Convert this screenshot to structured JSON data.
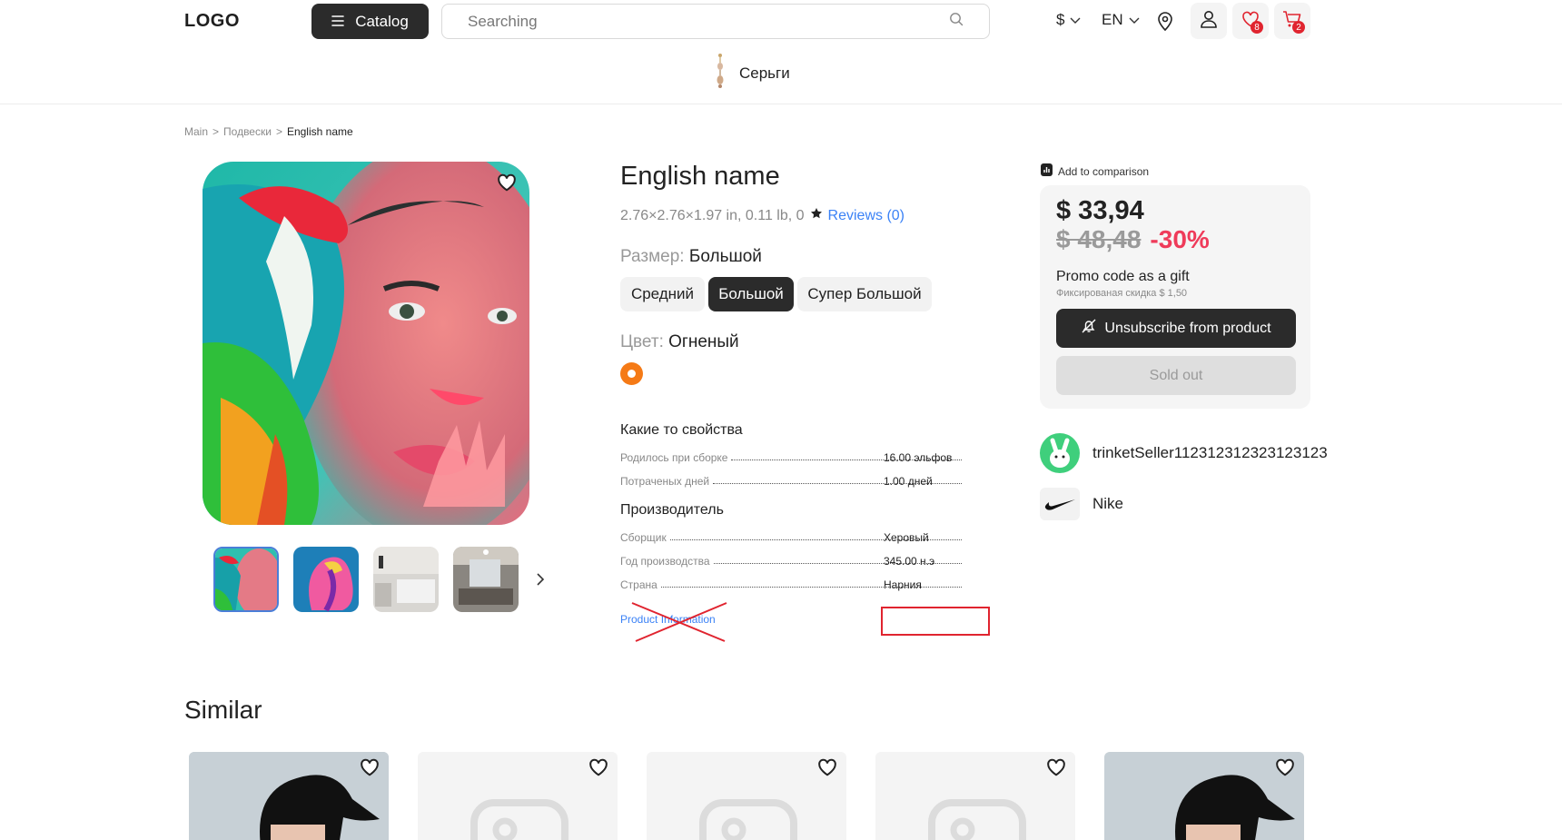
{
  "header": {
    "logo": "LOGO",
    "catalog_label": "Catalog",
    "search_placeholder": "Searching",
    "currency": "$",
    "language": "EN",
    "favorites_count": "8",
    "cart_count": "2"
  },
  "nav": {
    "category": "Серьги"
  },
  "breadcrumbs": {
    "home": "Main",
    "sep": ">",
    "section": "Подвески",
    "current": "English name"
  },
  "product": {
    "title": "English name",
    "dimensions": "2.76×2.76×1.97 in, 0.11 lb, 0",
    "reviews": "Reviews (0)",
    "size_label": "Размер:",
    "size_value": "Большой",
    "sizes": [
      "Средний",
      "Большой",
      "Супер Большой"
    ],
    "color_label": "Цвет:",
    "color_value": "Огненый",
    "color_swatch": "#f57a16"
  },
  "properties": {
    "title": "Какие то свойства",
    "rows": [
      {
        "key": "Родилось при сборке",
        "value": "16.00 эльфов"
      },
      {
        "key": "Потраченых дней",
        "value": "1.00 дней"
      }
    ]
  },
  "manufacturer": {
    "title": "Производитель",
    "rows": [
      {
        "key": "Сборщик",
        "value": "Херовый"
      },
      {
        "key": "Год производства",
        "value": "345.00 н.э"
      },
      {
        "key": "Страна",
        "value": "Нарния"
      }
    ],
    "info_link": "Product Information"
  },
  "purchase": {
    "comparison": "Add to comparison",
    "price": "$ 33,94",
    "old_price": "$ 48,48",
    "discount": "-30%",
    "promo": "Promo code as a gift",
    "promo_sub": "Фиксированая скидка $ 1,50",
    "unsubscribe": "Unsubscribe from product",
    "sold_out": "Sold out"
  },
  "seller": {
    "name": "trinketSeller112312312323123123",
    "brand": "Nike"
  },
  "similar": {
    "title": "Similar"
  },
  "colors": {
    "accent_dark": "#2b2b2b",
    "discount": "#ef3b5a",
    "link": "#3b82f6",
    "badge": "#e0242f"
  }
}
